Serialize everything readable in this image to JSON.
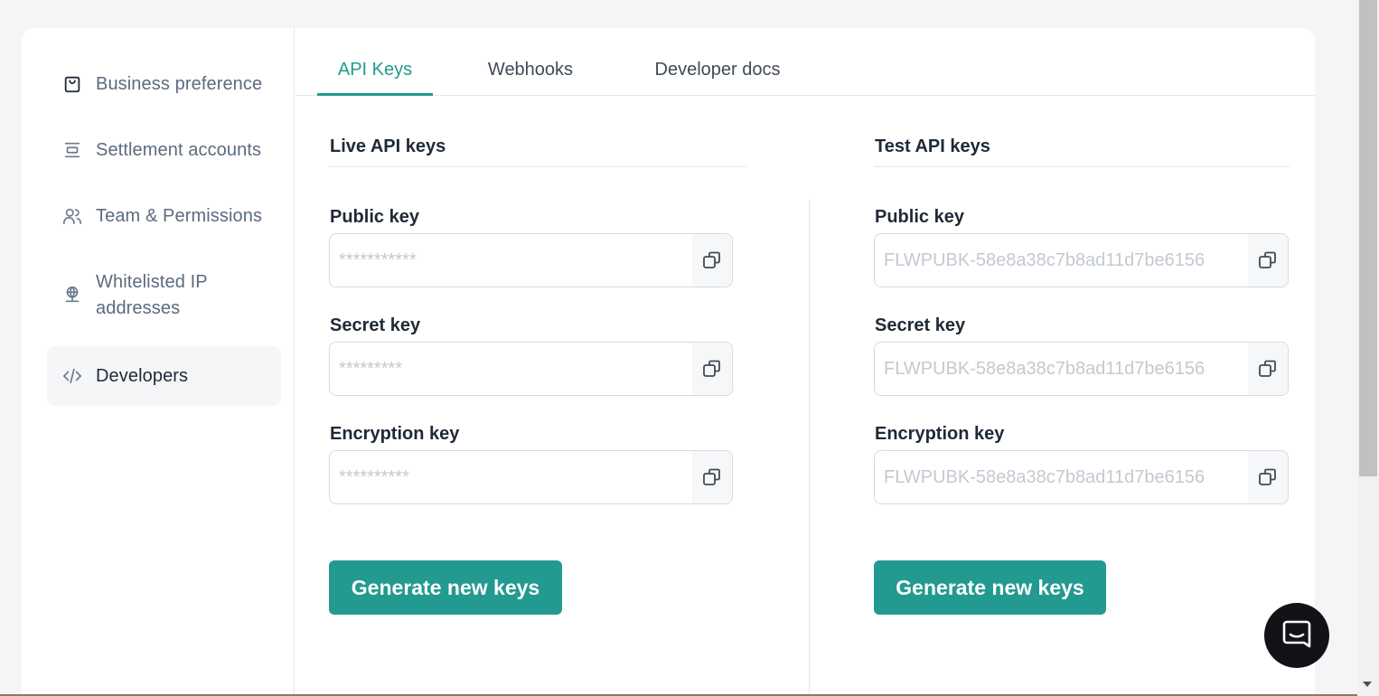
{
  "sidebar": {
    "items": [
      {
        "label": "Business preference",
        "icon": "shopping-bag-icon"
      },
      {
        "label": "Settlement accounts",
        "icon": "layers-icon"
      },
      {
        "label": "Team & Permissions",
        "icon": "users-icon"
      },
      {
        "label": "Whitelisted IP addresses",
        "icon": "globe-network-icon"
      },
      {
        "label": "Developers",
        "icon": "code-icon",
        "active": true
      }
    ]
  },
  "tabs": [
    {
      "label": "API Keys",
      "active": true
    },
    {
      "label": "Webhooks"
    },
    {
      "label": "Developer docs"
    }
  ],
  "live": {
    "title": "Live API keys",
    "public_label": "Public key",
    "public_value": "***********",
    "secret_label": "Secret key",
    "secret_value": "*********",
    "encryption_label": "Encryption key",
    "encryption_value": "**********",
    "button": "Generate new keys"
  },
  "test": {
    "title": "Test API keys",
    "public_label": "Public key",
    "public_value": "FLWPUBK-58e8a38c7b8ad11d7be6156",
    "secret_label": "Secret key",
    "secret_value": "FLWPUBK-58e8a38c7b8ad11d7be6156",
    "encryption_label": "Encryption key",
    "encryption_value": "FLWPUBK-58e8a38c7b8ad11d7be6156",
    "button": "Generate new keys"
  },
  "colors": {
    "accent": "#239a90",
    "muted_text": "#5b6b7f",
    "chat_bubble": "#111316"
  }
}
